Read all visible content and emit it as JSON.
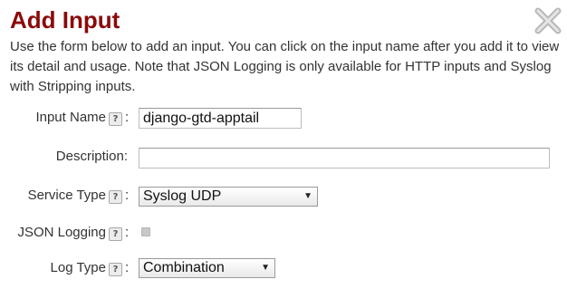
{
  "dialog": {
    "title": "Add Input",
    "intro": "Use the form below to add an input. You can click on the input name after you add it to view its detail and usage. Note that JSON Logging is only available for HTTP inputs and Syslog with Stripping inputs."
  },
  "help_glyph": "?",
  "colon": ":",
  "form": {
    "input_name": {
      "label": "Input Name",
      "value": "django-gtd-apptail"
    },
    "description": {
      "label": "Description:",
      "value": ""
    },
    "service_type": {
      "label": "Service Type",
      "selected": "Syslog UDP"
    },
    "json_logging": {
      "label": "JSON Logging",
      "checked": false
    },
    "log_type": {
      "label": "Log Type",
      "selected": "Combination"
    }
  },
  "select_arrow": "▼",
  "colors": {
    "title": "#8b0a0a",
    "text": "#333333"
  },
  "icons": {
    "close": "close-x-icon",
    "dropdown": "chevron-down-icon"
  }
}
